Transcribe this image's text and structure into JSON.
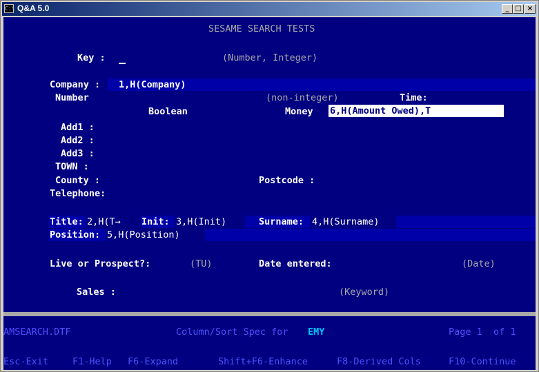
{
  "window": {
    "title": "Q&A 5.0"
  },
  "form": {
    "heading": "SESAME SEARCH TESTS",
    "key_label": "Key :",
    "key_hint": "(Number, Integer)",
    "company_label": "Company :",
    "company_field": "1,H(Company)",
    "number_label": "Number",
    "number_hint": "(non-integer)",
    "time_label": "Time:",
    "boolean_label": "Boolean",
    "money_label": "Money",
    "money_field": "6,H(Amount Owed),T",
    "add1_label": "Add1 :",
    "add2_label": "Add2 :",
    "add3_label": "Add3 :",
    "town_label": "TOWN :",
    "county_label": "County :",
    "postcode_label": "Postcode :",
    "telephone_label": "Telephone:",
    "title_label": "Title:",
    "title_field": "2,H(T→",
    "init_label": "Init:",
    "init_field": "3,H(Init)",
    "surname_label": "Surname:",
    "surname_field": "4,H(Surname)",
    "position_label": "Position:",
    "position_field": "5,H(Position)",
    "live_label": "Live or Prospect?:",
    "live_hint": "(TU)",
    "date_label": "Date entered:",
    "date_hint": "(Date)",
    "sales_label": "Sales :",
    "sales_hint": "(Keyword)"
  },
  "status": {
    "file": "AMSEARCH.DTF",
    "spec": "Column/Sort Spec for",
    "spec_name": "EMY",
    "page": "Page 1  of 1"
  },
  "keys": {
    "esc": "Esc-Exit",
    "f1": "F1-Help",
    "f6": "F6-Expand",
    "shift_f6": "Shift+F6-Enhance",
    "f8": "F8-Derived Cols",
    "f10": "F10-Continue"
  }
}
